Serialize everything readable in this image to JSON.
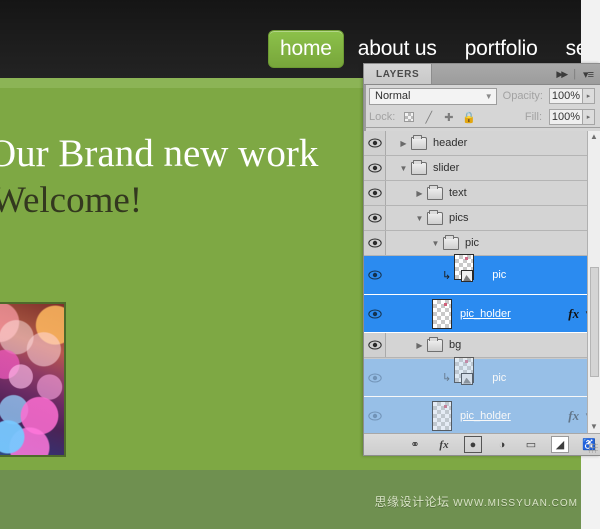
{
  "site": {
    "nav": [
      {
        "label": "home",
        "active": true
      },
      {
        "label": "about us",
        "active": false
      },
      {
        "label": "portfolio",
        "active": false
      },
      {
        "label": "servi",
        "active": false
      }
    ],
    "hero": {
      "line1": "Our Brand new work",
      "line2": "Welcome!"
    },
    "colors": {
      "topbar": "#1d1d1d",
      "green_band": "#8cb456",
      "canvas_green": "#7ea844",
      "outside_green": "#6f9050",
      "active_nav": "#8cc14a"
    },
    "watermark": {
      "cn": "思缘设计论坛",
      "url": "WWW.MISSYUAN.COM"
    },
    "image_name": "bokeh-photo"
  },
  "panel": {
    "tab_label": "LAYERS",
    "tab_icons": [
      "collapse-arrows-icon",
      "panel-menu-icon"
    ],
    "blend_mode": "Normal",
    "opacity_label": "Opacity:",
    "opacity_value": "100%",
    "lock_label": "Lock:",
    "lock_icons": [
      "lock-transparency-icon",
      "lock-image-icon",
      "lock-position-icon",
      "lock-all-icon"
    ],
    "fill_label": "Fill:",
    "fill_value": "100%",
    "layers": [
      {
        "name": "header",
        "type": "group",
        "indent": 0,
        "twisty": "collapsed",
        "selected": false,
        "ghost": false,
        "fx": false,
        "clipped": false
      },
      {
        "name": "slider",
        "type": "group",
        "indent": 0,
        "twisty": "expanded",
        "selected": false,
        "ghost": false,
        "fx": false,
        "clipped": false
      },
      {
        "name": "text",
        "type": "group",
        "indent": 1,
        "twisty": "collapsed",
        "selected": false,
        "ghost": false,
        "fx": false,
        "clipped": false
      },
      {
        "name": "pics",
        "type": "group",
        "indent": 1,
        "twisty": "expanded",
        "selected": false,
        "ghost": false,
        "fx": false,
        "clipped": false
      },
      {
        "name": "pic",
        "type": "group",
        "indent": 2,
        "twisty": "expanded",
        "selected": false,
        "ghost": false,
        "fx": false,
        "clipped": false
      },
      {
        "name": "pic",
        "type": "layer",
        "indent": 3,
        "twisty": "none",
        "selected": true,
        "ghost": false,
        "fx": false,
        "clipped": true
      },
      {
        "name": "pic_holder",
        "type": "layer",
        "indent": 3,
        "twisty": "none",
        "selected": true,
        "ghost": false,
        "fx": true,
        "clipped": false
      },
      {
        "name": "bg",
        "type": "group",
        "indent": 1,
        "twisty": "collapsed",
        "selected": false,
        "ghost": false,
        "fx": false,
        "clipped": false
      },
      {
        "name": "pic",
        "type": "layer",
        "indent": 3,
        "twisty": "none",
        "selected": false,
        "ghost": true,
        "fx": false,
        "clipped": true
      },
      {
        "name": "pic_holder",
        "type": "layer",
        "indent": 3,
        "twisty": "none",
        "selected": false,
        "ghost": true,
        "fx": true,
        "clipped": false
      }
    ],
    "footer_icons": [
      {
        "name": "link-layers-icon",
        "glyph": "∞",
        "active": false
      },
      {
        "name": "layer-style-fx-icon",
        "glyph": "fx",
        "active": false
      },
      {
        "name": "add-mask-icon",
        "glyph": "○",
        "active": false
      },
      {
        "name": "adjustment-layer-icon",
        "glyph": "◑",
        "active": false
      },
      {
        "name": "new-group-icon",
        "glyph": "▭",
        "active": false
      },
      {
        "name": "new-layer-icon",
        "glyph": "◥",
        "active": true
      },
      {
        "name": "delete-layer-icon",
        "glyph": "☗",
        "active": false
      }
    ],
    "scrollbar": {
      "up": "▲",
      "down": "▼"
    },
    "colors": {
      "selection_blue": "#2b8bf0",
      "ghost_blue": "#8dbceb",
      "panel_bg": "#d6d6d6"
    }
  }
}
